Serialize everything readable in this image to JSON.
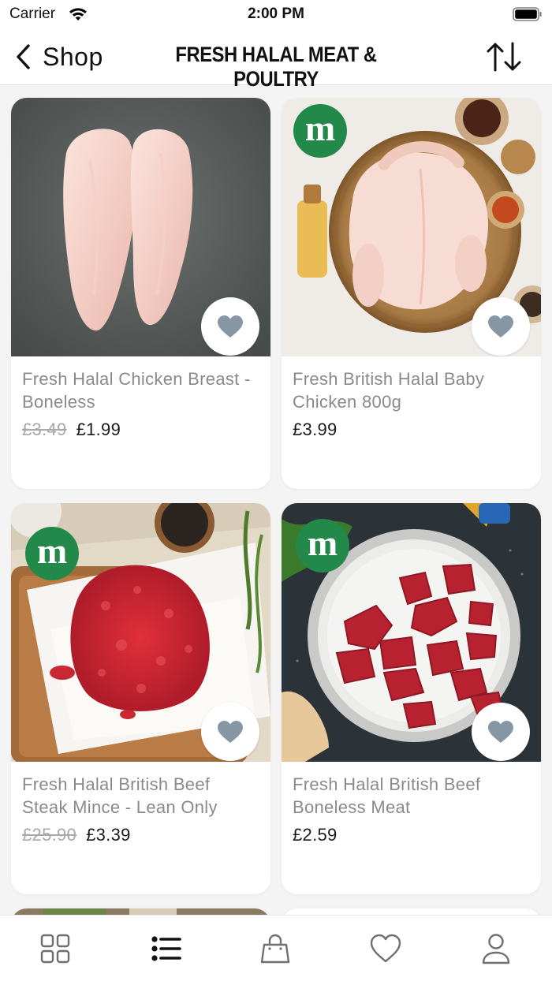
{
  "status_bar": {
    "carrier": "Carrier",
    "time": "2:00 PM"
  },
  "nav": {
    "back_label": "Shop",
    "title": "FRESH HALAL MEAT & POULTRY"
  },
  "products": [
    {
      "name": "Fresh Halal Chicken Breast - Boneless",
      "old_price": "£3.49",
      "price": "£1.99",
      "badge": "",
      "favorite": false
    },
    {
      "name": "Fresh British Halal Baby Chicken 800g",
      "old_price": "",
      "price": "£3.99",
      "badge": "m",
      "favorite": false
    },
    {
      "name": "Fresh Halal British Beef Steak Mince - Lean Only",
      "old_price": "£25.90",
      "price": "£3.39",
      "badge": "m",
      "favorite": false
    },
    {
      "name": "Fresh Halal British Beef Boneless Meat",
      "old_price": "",
      "price": "£2.59",
      "badge": "m",
      "favorite": false
    }
  ],
  "tabs": [
    {
      "name": "home",
      "icon": "grid-icon",
      "active": false
    },
    {
      "name": "categories",
      "icon": "list-icon",
      "active": true
    },
    {
      "name": "basket",
      "icon": "bag-icon",
      "active": false
    },
    {
      "name": "favourites",
      "icon": "heart-icon",
      "active": false
    },
    {
      "name": "account",
      "icon": "user-icon",
      "active": false
    }
  ],
  "colors": {
    "badge_green": "#23894a",
    "heart": "#8696a3",
    "icon_gray": "#6f6f6f",
    "active_icon": "#111111"
  }
}
